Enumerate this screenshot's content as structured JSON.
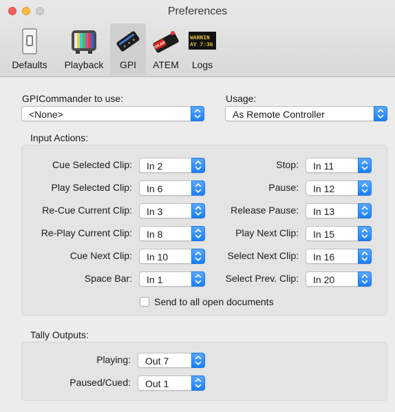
{
  "window": {
    "title": "Preferences"
  },
  "toolbar": [
    {
      "id": "defaults",
      "label": "Defaults",
      "icon": "switch-icon",
      "selected": false
    },
    {
      "id": "playback",
      "label": "Playback",
      "icon": "tv-icon",
      "selected": false
    },
    {
      "id": "gpi",
      "label": "GPI",
      "icon": "gpi-device-icon",
      "selected": true
    },
    {
      "id": "atem",
      "label": "ATEM",
      "icon": "atem-tally-icon",
      "selected": false
    },
    {
      "id": "logs",
      "label": "Logs",
      "icon": "log-display-icon",
      "selected": false
    }
  ],
  "logs_icon_text": [
    "WARNIN",
    "AY 7:36"
  ],
  "atem_icon_text": "ON AIR",
  "gpi": {
    "commander_label": "GPICommander to use:",
    "commander_value": "<None>",
    "usage_label": "Usage:",
    "usage_value": "As Remote Controller"
  },
  "input_actions": {
    "title": "Input Actions:",
    "left": [
      {
        "label": "Cue Selected Clip:",
        "value": "In 2"
      },
      {
        "label": "Play Selected Clip:",
        "value": "In 6"
      },
      {
        "label": "Re-Cue Current Clip:",
        "value": "In 3"
      },
      {
        "label": "Re-Play Current Clip:",
        "value": "In 8"
      },
      {
        "label": "Cue Next Clip:",
        "value": "In 10"
      },
      {
        "label": "Space Bar:",
        "value": "In 1"
      }
    ],
    "right": [
      {
        "label": "Stop:",
        "value": "In 11"
      },
      {
        "label": "Pause:",
        "value": "In 12"
      },
      {
        "label": "Release Pause:",
        "value": "In 13"
      },
      {
        "label": "Play Next Clip:",
        "value": "In 15"
      },
      {
        "label": "Select Next Clip:",
        "value": "In 16"
      },
      {
        "label": "Select Prev. Clip:",
        "value": "In 20"
      }
    ],
    "send_all_label": "Send to all open documents",
    "send_all_checked": false
  },
  "tally": {
    "title": "Tally Outputs:",
    "rows": [
      {
        "label": "Playing:",
        "value": "Out 7"
      },
      {
        "label": "Paused/Cued:",
        "value": "Out 1"
      }
    ]
  },
  "colors": {
    "accent": "#1d7ff5",
    "background": "#ececec",
    "group": "#e4e4e4"
  }
}
